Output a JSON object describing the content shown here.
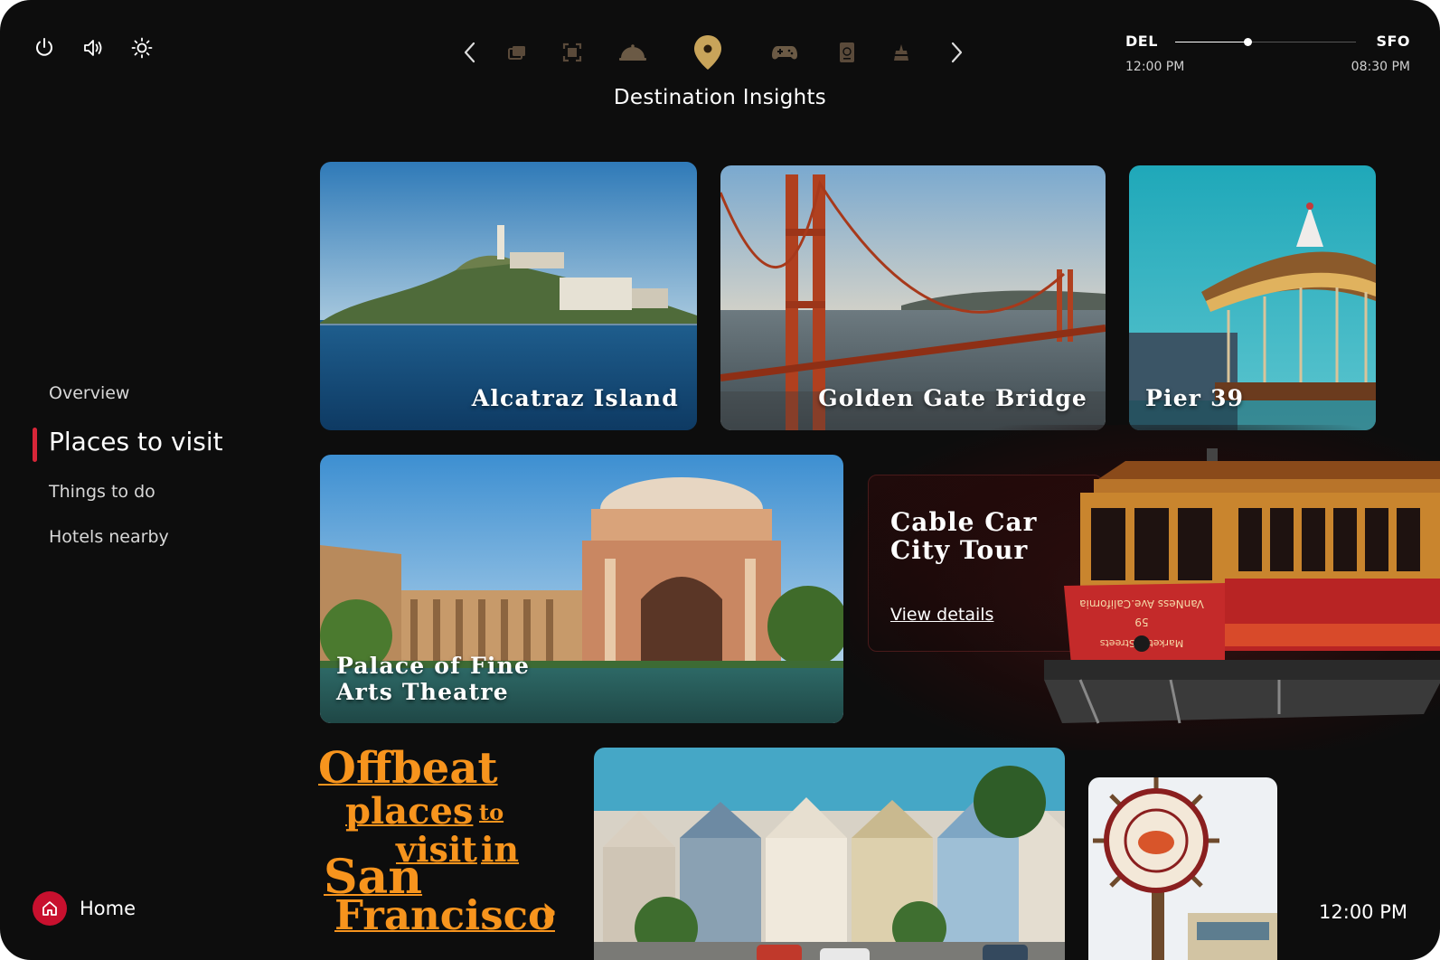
{
  "header": {
    "title": "Destination Insights",
    "system_icons": [
      "power-icon",
      "volume-icon",
      "brightness-icon"
    ],
    "nav_icons": [
      "chevron-left-icon",
      "photos-icon",
      "screen-icon",
      "dining-cloche-icon",
      "location-pin-icon",
      "gamepad-icon",
      "passport-icon",
      "monument-icon",
      "chevron-right-icon"
    ],
    "active_nav": "location-pin-icon"
  },
  "flight": {
    "origin": "DEL",
    "destination": "SFO",
    "departure_time": "12:00 PM",
    "arrival_time": "08:30 PM",
    "progress": 0.4
  },
  "sidebar": {
    "items": [
      {
        "label": "Overview"
      },
      {
        "label": "Places to visit"
      },
      {
        "label": "Things to do"
      },
      {
        "label": "Hotels nearby"
      }
    ],
    "active": "Places to visit"
  },
  "places": {
    "alcatraz": "Alcatraz Island",
    "golden_gate": "Golden Gate Bridge",
    "pier39": "Pier 39",
    "palace_line1": "Palace of Fine",
    "palace_line2": "Arts Theatre"
  },
  "feature": {
    "title_line1": "Cable Car",
    "title_line2": "City Tour",
    "link": "View details",
    "sign_line1": "VanNess Ave.California",
    "sign_number": "59",
    "sign_line2": "Market & Streets"
  },
  "offbeat": {
    "line1": "Offbeat",
    "line2a": "places",
    "line2b": "to",
    "line3a": "visit",
    "line3b": "in",
    "line4": "San",
    "line5": "Francisco",
    "arrow": "›"
  },
  "footer": {
    "home_label": "Home",
    "clock": "12:00 PM"
  },
  "colors": {
    "background": "#0d0d0d",
    "accent_red": "#c8102e",
    "offbeat_orange": "#f7941d"
  }
}
